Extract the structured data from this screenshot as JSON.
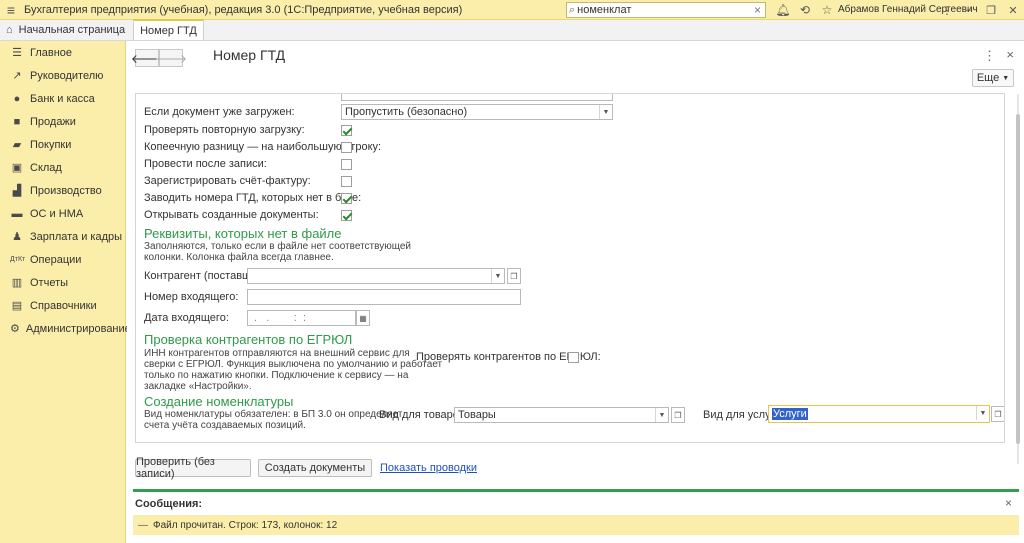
{
  "titlebar": {
    "title": "Бухгалтерия предприятия (учебная), редакция 3.0  (1С:Предприятие, учебная версия)",
    "search_value": "номенклат",
    "user": "Абрамов Геннадий Сергеевич"
  },
  "tabs": {
    "home": "Начальная страница",
    "active": "Номер ГТД"
  },
  "sidebar": {
    "items": [
      {
        "label": "Главное",
        "icon": "list-icon"
      },
      {
        "label": "Руководителю",
        "icon": "chart-icon"
      },
      {
        "label": "Банк и касса",
        "icon": "coin-icon"
      },
      {
        "label": "Продажи",
        "icon": "bag-icon"
      },
      {
        "label": "Покупки",
        "icon": "cart-icon"
      },
      {
        "label": "Склад",
        "icon": "box-icon"
      },
      {
        "label": "Производство",
        "icon": "factory-icon"
      },
      {
        "label": "ОС и НМА",
        "icon": "truck-icon"
      },
      {
        "label": "Зарплата и кадры",
        "icon": "person-icon"
      },
      {
        "label": "Операции",
        "icon": "dt-kt-icon"
      },
      {
        "label": "Отчеты",
        "icon": "bar-chart-icon"
      },
      {
        "label": "Справочники",
        "icon": "book-icon"
      },
      {
        "label": "Администрирование",
        "icon": "gear-icon"
      }
    ]
  },
  "form": {
    "title": "Номер ГТД",
    "more_label": "Еще",
    "if_loaded_label": "Если документ уже загружен:",
    "if_loaded_value": "Пропустить (безопасно)",
    "options": [
      {
        "label": "Проверять повторную загрузку:",
        "checked": true
      },
      {
        "label": "Копеечную разницу — на наибольшую строку:",
        "checked": false
      },
      {
        "label": "Провести после записи:",
        "checked": false
      },
      {
        "label": "Зарегистрировать счёт-фактуру:",
        "checked": false
      },
      {
        "label": "Заводить номера ГТД, которых нет в базе:",
        "checked": true
      },
      {
        "label": "Открывать созданные документы:",
        "checked": true
      }
    ],
    "requisites": {
      "title": "Реквизиты, которых нет в файле",
      "hint_line1": "Заполняются, только если в файле нет соответствующей",
      "hint_line2": "колонки. Колонка файла всегда главнее.",
      "counterparty_label": "Контрагент (поставщик):",
      "incoming_number_label": "Номер входящего:",
      "incoming_date_label": "Дата входящего:",
      "incoming_date_value": " .   .        :  :"
    },
    "egrul": {
      "title": "Проверка контрагентов по ЕГРЮЛ",
      "hint_line1": "ИНН контрагентов отправляются на внешний сервис для",
      "hint_line2": "сверки с ЕГРЮЛ. Функция выключена по умолчанию и работает",
      "hint_line3": "только по нажатию кнопки. Подключение к сервису — на",
      "hint_line4": "закладке «Настройки».",
      "check_label": "Проверять контрагентов по ЕГРЮЛ:"
    },
    "nomenclature": {
      "title": "Создание номенклатуры",
      "hint_line1": "Вид номенклатуры обязателен: в БП 3.0 он определяет",
      "hint_line2": "счета учёта создаваемых позиций.",
      "goods_label": "Вид для товаров:",
      "goods_value": "Товары",
      "services_label": "Вид для услуг:",
      "services_value": "Услуги"
    },
    "buttons": {
      "check": "Проверить (без записи)",
      "create": "Создать документы",
      "show_postings": "Показать проводки"
    }
  },
  "messages": {
    "title": "Сообщения:",
    "text": "Файл прочитан. Строк: 173, колонок: 12"
  },
  "colors": {
    "accent_yellow": "#fbeeaa",
    "section_green": "#2f9a4a",
    "check_green": "#2a8a2a",
    "link_blue": "#1f4fbf"
  }
}
